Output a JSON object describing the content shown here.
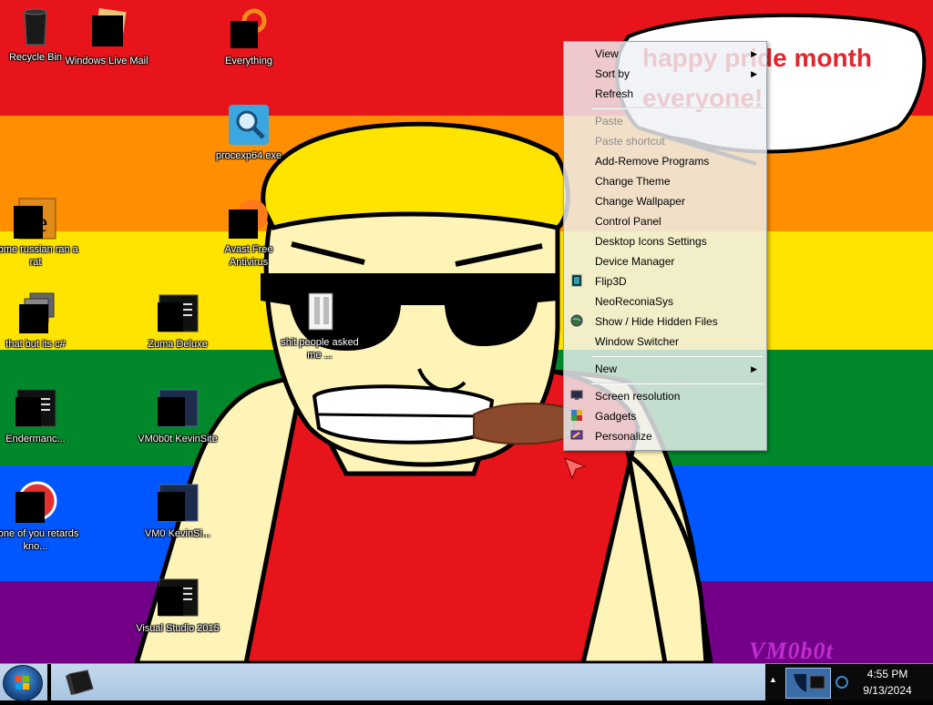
{
  "wallpaper": {
    "bubble_line1": "happy pride month",
    "bubble_line2": "everyone!",
    "signature": "VM0b0t",
    "stripe_colors": [
      "#e8141b",
      "#ff8f00",
      "#ffe400",
      "#01882b",
      "#0056ff",
      "#730188"
    ]
  },
  "desktop_icons": [
    {
      "label": "Recycle Bin"
    },
    {
      "label": "Windows Live Mail"
    },
    {
      "label": "Everything"
    },
    {
      "label": "procexp64.exe"
    },
    {
      "label": "some russian ran a rat"
    },
    {
      "label": "Avast Free Antivirus"
    },
    {
      "label": "that but its c#"
    },
    {
      "label": "Zuma Deluxe"
    },
    {
      "label": "shit people asked me ..."
    },
    {
      "label": "Endermanc..."
    },
    {
      "label": "VM0b0t KevinSite"
    },
    {
      "label": "none of you retards kno..."
    },
    {
      "label": "VM0 KevinSi..."
    },
    {
      "label": "Visual Studio 2015"
    }
  ],
  "context_menu": {
    "items": [
      {
        "label": "View",
        "submenu": true,
        "disabled": false,
        "icon": ""
      },
      {
        "label": "Sort by",
        "submenu": true,
        "disabled": false,
        "icon": ""
      },
      {
        "label": "Refresh",
        "submenu": false,
        "disabled": false,
        "icon": ""
      },
      {
        "label": "Paste",
        "submenu": false,
        "disabled": true,
        "icon": ""
      },
      {
        "label": "Paste shortcut",
        "submenu": false,
        "disabled": true,
        "icon": ""
      },
      {
        "label": "Add-Remove Programs",
        "submenu": false,
        "disabled": false,
        "icon": ""
      },
      {
        "label": "Change Theme",
        "submenu": false,
        "disabled": false,
        "icon": ""
      },
      {
        "label": "Change Wallpaper",
        "submenu": false,
        "disabled": false,
        "icon": ""
      },
      {
        "label": "Control Panel",
        "submenu": false,
        "disabled": false,
        "icon": ""
      },
      {
        "label": "Desktop Icons Settings",
        "submenu": false,
        "disabled": false,
        "icon": ""
      },
      {
        "label": "Device Manager",
        "submenu": false,
        "disabled": false,
        "icon": ""
      },
      {
        "label": "Flip3D",
        "submenu": false,
        "disabled": false,
        "icon": "flip3d-icon"
      },
      {
        "label": "NeoReconiaSys",
        "submenu": false,
        "disabled": false,
        "icon": ""
      },
      {
        "label": "Show / Hide Hidden Files",
        "submenu": false,
        "disabled": false,
        "icon": "globe-icon"
      },
      {
        "label": "Window Switcher",
        "submenu": false,
        "disabled": false,
        "icon": ""
      },
      {
        "label": "New",
        "submenu": true,
        "disabled": false,
        "icon": ""
      },
      {
        "label": "Screen resolution",
        "submenu": false,
        "disabled": false,
        "icon": "monitor-icon"
      },
      {
        "label": "Gadgets",
        "submenu": false,
        "disabled": false,
        "icon": "gadgets-icon"
      },
      {
        "label": "Personalize",
        "submenu": false,
        "disabled": false,
        "icon": "personalize-icon"
      }
    ]
  },
  "taskbar": {
    "time": "4:55 PM",
    "date": "9/13/2024"
  }
}
